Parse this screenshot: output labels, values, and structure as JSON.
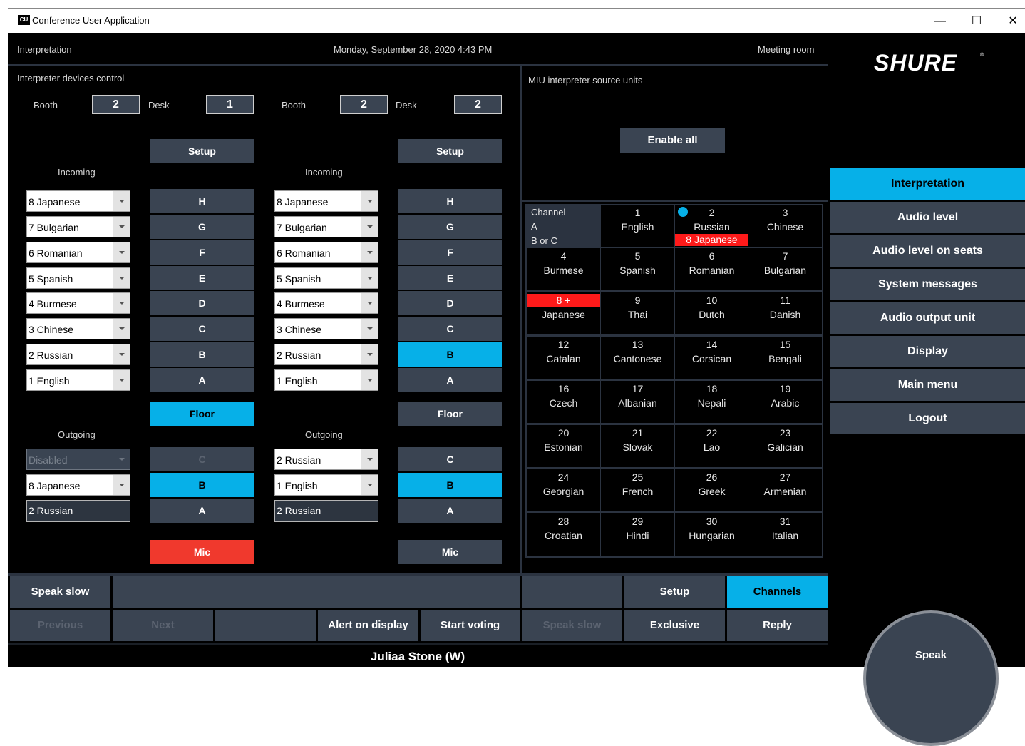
{
  "window": {
    "title": "Conference User Application",
    "logo_text": "CU"
  },
  "header": {
    "left": "Interpretation",
    "center": "Monday, September 28, 2020 4:43 PM",
    "right": "Meeting room"
  },
  "brand": {
    "logo": "SHURE"
  },
  "devices": {
    "title": "Interpreter devices control",
    "booth_label": "Booth",
    "desk_label": "Desk",
    "incoming_label": "Incoming",
    "outgoing_label": "Outgoing",
    "setup_label": "Setup",
    "floor_label": "Floor",
    "mic_label": "Mic",
    "units": [
      {
        "booth": "2",
        "desk": "1",
        "incoming": [
          "8 Japanese",
          "7 Bulgarian",
          "6 Romanian",
          "5 Spanish",
          "4 Burmese",
          "3 Chinese",
          "2 Russian",
          "1 English"
        ],
        "incoming_buttons": [
          "H",
          "G",
          "F",
          "E",
          "D",
          "C",
          "B",
          "A"
        ],
        "outgoing": [
          "Disabled",
          "8 Japanese",
          "2 Russian"
        ],
        "outgoing_buttons": [
          "C",
          "B",
          "A"
        ]
      },
      {
        "booth": "2",
        "desk": "2",
        "incoming": [
          "8 Japanese",
          "7 Bulgarian",
          "6 Romanian",
          "5 Spanish",
          "4 Burmese",
          "3 Chinese",
          "2 Russian",
          "1 English"
        ],
        "incoming_buttons": [
          "H",
          "G",
          "F",
          "E",
          "D",
          "C",
          "B",
          "A"
        ],
        "outgoing": [
          "2 Russian",
          "1 English",
          "2 Russian"
        ],
        "outgoing_buttons": [
          "C",
          "B",
          "A"
        ]
      }
    ]
  },
  "miu": {
    "title": "MIU interpreter source units",
    "enable_all": "Enable all",
    "row_labels": {
      "channel": "Channel",
      "a": "A",
      "b_or_c": "B or C"
    },
    "b_or_c_value": "8 Japanese",
    "channels": [
      {
        "num": "1",
        "lang": "English"
      },
      {
        "num": "2",
        "lang": "Russian"
      },
      {
        "num": "3",
        "lang": "Chinese"
      },
      {
        "num": "4",
        "lang": "Burmese"
      },
      {
        "num": "5",
        "lang": "Spanish"
      },
      {
        "num": "6",
        "lang": "Romanian"
      },
      {
        "num": "7",
        "lang": "Bulgarian"
      },
      {
        "num": "8 +",
        "lang": "Japanese"
      },
      {
        "num": "9",
        "lang": "Thai"
      },
      {
        "num": "10",
        "lang": "Dutch"
      },
      {
        "num": "11",
        "lang": "Danish"
      },
      {
        "num": "12",
        "lang": "Catalan"
      },
      {
        "num": "13",
        "lang": "Cantonese"
      },
      {
        "num": "14",
        "lang": "Corsican"
      },
      {
        "num": "15",
        "lang": "Bengali"
      },
      {
        "num": "16",
        "lang": "Czech"
      },
      {
        "num": "17",
        "lang": "Albanian"
      },
      {
        "num": "18",
        "lang": "Nepali"
      },
      {
        "num": "19",
        "lang": "Arabic"
      },
      {
        "num": "20",
        "lang": "Estonian"
      },
      {
        "num": "21",
        "lang": "Slovak"
      },
      {
        "num": "22",
        "lang": "Lao"
      },
      {
        "num": "23",
        "lang": "Galician"
      },
      {
        "num": "24",
        "lang": "Georgian"
      },
      {
        "num": "25",
        "lang": "French"
      },
      {
        "num": "26",
        "lang": "Greek"
      },
      {
        "num": "27",
        "lang": "Armenian"
      },
      {
        "num": "28",
        "lang": "Croatian"
      },
      {
        "num": "29",
        "lang": "Hindi"
      },
      {
        "num": "30",
        "lang": "Hungarian"
      },
      {
        "num": "31",
        "lang": "Italian"
      }
    ]
  },
  "menu": [
    "Interpretation",
    "Audio level",
    "Audio level on seats",
    "System messages",
    "Audio output unit",
    "Display",
    "Main menu",
    "Logout"
  ],
  "bottom": {
    "speak_slow": "Speak slow",
    "setup": "Setup",
    "channels": "Channels",
    "previous": "Previous",
    "next": "Next",
    "alert_on_display": "Alert on display",
    "start_voting": "Start voting",
    "speak_slow_2": "Speak slow",
    "exclusive": "Exclusive",
    "reply": "Reply",
    "user": "Juliaa Stone (W)",
    "speak": "Speak"
  },
  "colors": {
    "accent": "#06b0e8",
    "panel": "#3a4452",
    "alert": "#f0392d"
  }
}
